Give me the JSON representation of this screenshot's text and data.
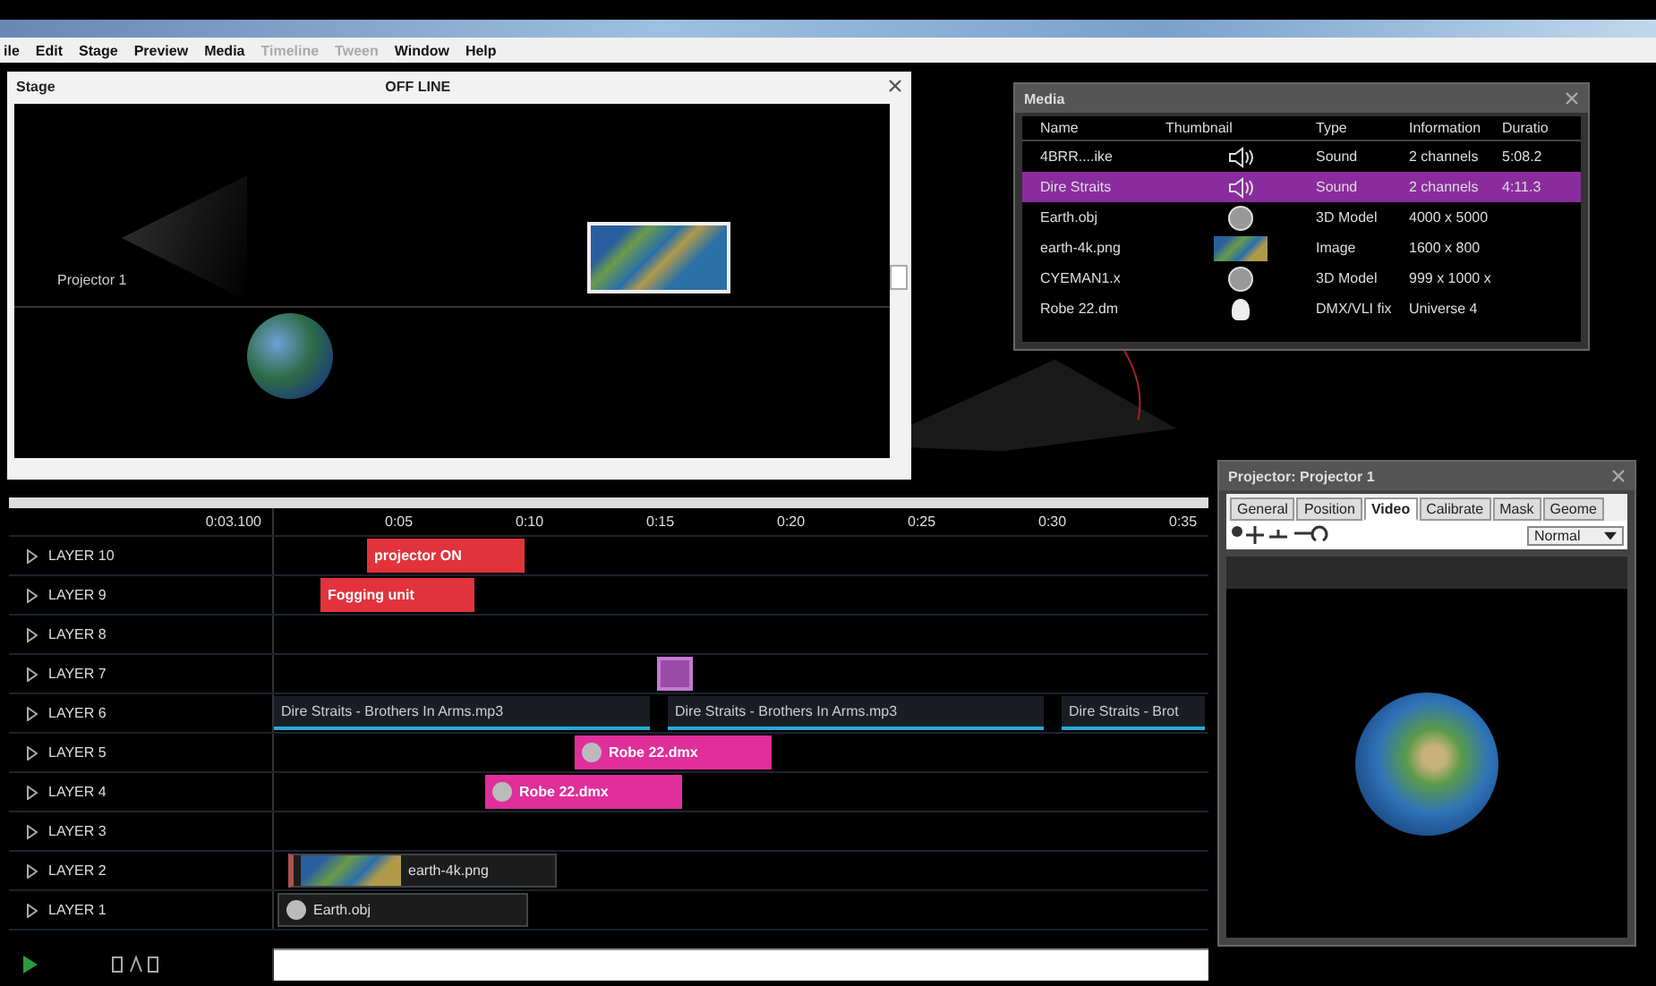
{
  "menu": [
    {
      "label": "ile",
      "disabled": false
    },
    {
      "label": "Edit",
      "disabled": false
    },
    {
      "label": "Stage",
      "disabled": false
    },
    {
      "label": "Preview",
      "disabled": false
    },
    {
      "label": "Media",
      "disabled": false
    },
    {
      "label": "Timeline",
      "disabled": true
    },
    {
      "label": "Tween",
      "disabled": true
    },
    {
      "label": "Window",
      "disabled": false
    },
    {
      "label": "Help",
      "disabled": false
    }
  ],
  "stage": {
    "title": "Stage",
    "status": "OFF LINE",
    "projector_label": "Projector 1"
  },
  "media": {
    "title": "Media",
    "columns": [
      "Name",
      "Thumbnail",
      "Type",
      "Information",
      "Duratio"
    ],
    "rows": [
      {
        "name": "4BRR....ike",
        "kind": "sound",
        "type": "Sound",
        "info": "2 channels",
        "duration": "5:08.2",
        "selected": false
      },
      {
        "name": "Dire Straits",
        "kind": "sound",
        "type": "Sound",
        "info": "2 channels",
        "duration": "4:11.3",
        "selected": true
      },
      {
        "name": "Earth.obj",
        "kind": "model",
        "type": "3D Model",
        "info": "4000 x 5000",
        "selected": false
      },
      {
        "name": "earth-4k.png",
        "kind": "image",
        "type": "Image",
        "info": "1600 x 800",
        "selected": false
      },
      {
        "name": "CYEMAN1.x",
        "kind": "model",
        "type": "3D Model",
        "info": "999 x 1000 x",
        "selected": false
      },
      {
        "name": "Robe 22.dm",
        "kind": "light",
        "type": "DMX/VLI fix",
        "info": "Universe 4",
        "selected": false
      }
    ]
  },
  "timeline": {
    "time": "0:03.100",
    "ticks": [
      "0:05",
      "0:10",
      "0:15",
      "0:20",
      "0:25",
      "0:30",
      "0:35"
    ],
    "layers": [
      {
        "name": "LAYER 10",
        "clips": [
          {
            "kind": "cue",
            "label": "projector ON"
          }
        ]
      },
      {
        "name": "LAYER 9",
        "clips": [
          {
            "kind": "cue",
            "label": "Fogging unit"
          }
        ]
      },
      {
        "name": "LAYER 8"
      },
      {
        "name": "LAYER 7",
        "clips": [
          {
            "kind": "marker"
          }
        ]
      },
      {
        "name": "LAYER 6",
        "clips": [
          {
            "kind": "audio",
            "label": "Dire Straits - Brothers In Arms.mp3"
          },
          {
            "kind": "audio",
            "label": "Dire Straits - Brothers In Arms.mp3"
          },
          {
            "kind": "audio",
            "label": "Dire Straits - Brot"
          }
        ]
      },
      {
        "name": "LAYER 5",
        "clips": [
          {
            "kind": "dmx",
            "label": "Robe 22.dmx"
          }
        ]
      },
      {
        "name": "LAYER 4",
        "clips": [
          {
            "kind": "dmx",
            "label": "Robe 22.dmx"
          }
        ]
      },
      {
        "name": "LAYER 3"
      },
      {
        "name": "LAYER 2",
        "clips": [
          {
            "kind": "image",
            "label": "earth-4k.png"
          }
        ]
      },
      {
        "name": "LAYER 1",
        "clips": [
          {
            "kind": "model",
            "label": "Earth.obj"
          }
        ]
      }
    ]
  },
  "projector": {
    "title": "Projector: Projector 1",
    "tabs": [
      {
        "label": "General",
        "selected": false
      },
      {
        "label": "Position",
        "selected": false
      },
      {
        "label": "Video",
        "selected": true
      },
      {
        "label": "Calibrate",
        "selected": false
      },
      {
        "label": "Mask",
        "selected": false
      },
      {
        "label": "Geome",
        "selected": false
      }
    ],
    "blend_mode": "Normal"
  }
}
